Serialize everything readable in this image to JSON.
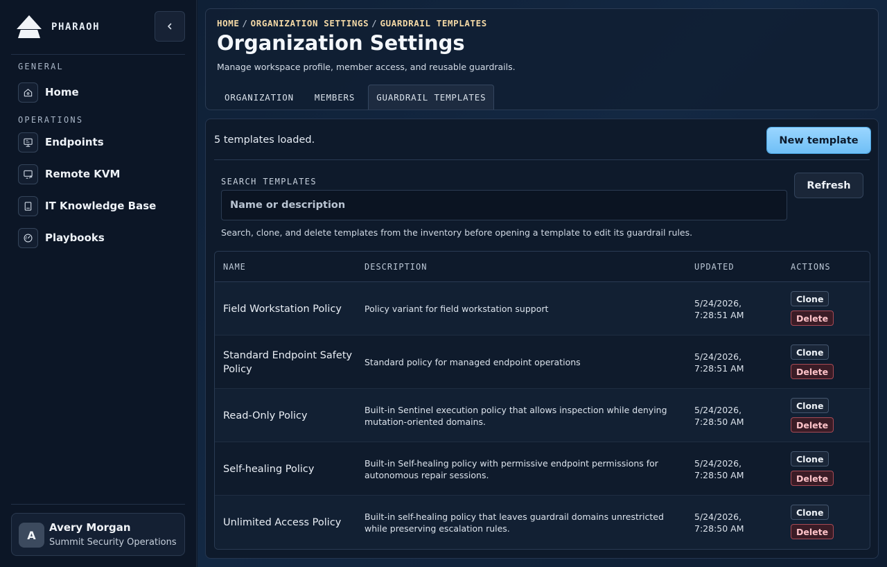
{
  "sidebar": {
    "brand": "PHARAOH",
    "sections": [
      {
        "title": "GENERAL"
      },
      {
        "title": "OPERATIONS"
      }
    ],
    "items": [
      {
        "label": "Home",
        "icon": "home-icon"
      },
      {
        "label": "Endpoints",
        "icon": "monitor-icon"
      },
      {
        "label": "Remote KVM",
        "icon": "remote-screen-icon"
      },
      {
        "label": "IT Knowledge Base",
        "icon": "book-icon"
      },
      {
        "label": "Playbooks",
        "icon": "gauge-icon"
      }
    ],
    "user": {
      "initial": "A",
      "name": "Avery Morgan",
      "org": "Summit Security Operations"
    }
  },
  "header": {
    "breadcrumb": [
      "HOME",
      "ORGANIZATION SETTINGS",
      "GUARDRAIL TEMPLATES"
    ],
    "breadcrumb_sep": "/",
    "title": "Organization Settings",
    "subtitle": "Manage workspace profile, member access, and reusable guardrails.",
    "tabs": [
      {
        "label": "ORGANIZATION",
        "active": false
      },
      {
        "label": "MEMBERS",
        "active": false
      },
      {
        "label": "GUARDRAIL TEMPLATES",
        "active": true
      }
    ]
  },
  "main": {
    "status": "5 templates loaded.",
    "new_label": "New template",
    "search": {
      "label": "SEARCH TEMPLATES",
      "placeholder": "Name or description",
      "value": ""
    },
    "refresh_label": "Refresh",
    "help": "Search, clone, and delete templates from the inventory before opening a template to edit its guardrail rules.",
    "table": {
      "columns": [
        "NAME",
        "DESCRIPTION",
        "UPDATED",
        "ACTIONS"
      ],
      "clone_label": "Clone",
      "delete_label": "Delete",
      "rows": [
        {
          "name": "Field Workstation Policy",
          "description": "Policy variant for field workstation support",
          "updated": "5/24/2026, 7:28:51 AM"
        },
        {
          "name": "Standard Endpoint Safety Policy",
          "description": "Standard policy for managed endpoint operations",
          "updated": "5/24/2026, 7:28:51 AM"
        },
        {
          "name": "Read-Only Policy",
          "description": "Built-in Sentinel execution policy that allows inspection while denying mutation-oriented domains.",
          "updated": "5/24/2026, 7:28:50 AM"
        },
        {
          "name": "Self-healing Policy",
          "description": "Built-in Self-healing policy with permissive endpoint permissions for autonomous repair sessions.",
          "updated": "5/24/2026, 7:28:50 AM"
        },
        {
          "name": "Unlimited Access Policy",
          "description": "Built-in self-healing policy that leaves guardrail domains unrestricted while preserving escalation rules.",
          "updated": "5/24/2026, 7:28:50 AM"
        }
      ]
    }
  },
  "colors": {
    "accent": "#7cc8fb",
    "breadcrumb": "#f4d9a6",
    "danger": "#a84a55"
  }
}
